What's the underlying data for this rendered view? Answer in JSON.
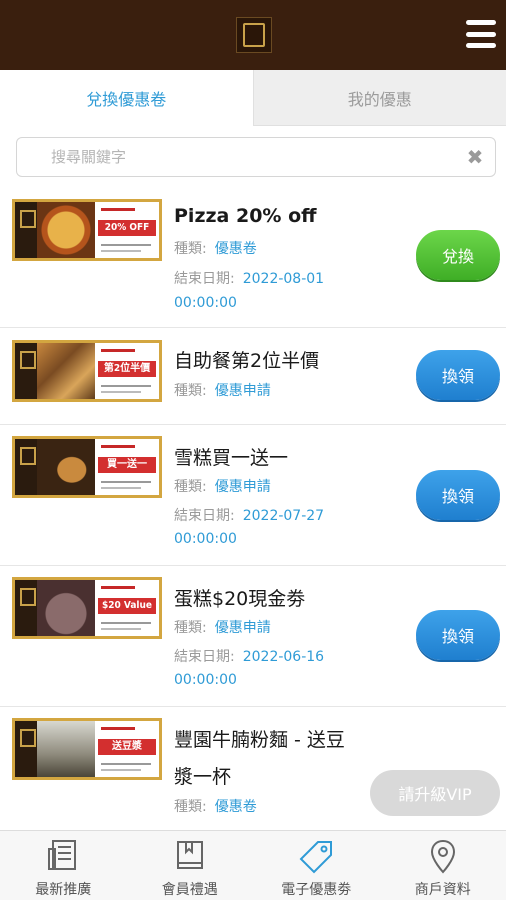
{
  "header": {
    "logo": "logo-icon",
    "menu": "hamburger-icon"
  },
  "tabs": {
    "redeem": "兌換優惠卷",
    "mine": "我的優惠"
  },
  "search": {
    "placeholder": "搜尋關鍵字",
    "clear": "✖"
  },
  "labels": {
    "type": "種類:",
    "end": "結束日期:"
  },
  "coupons": [
    {
      "title": "Pizza 20% off",
      "type": "優惠卷",
      "end_date": "2022-08-01",
      "end_time": "00:00:00",
      "button": "兌換",
      "button_color": "#4cbf2e",
      "thumb_text": "20% OFF"
    },
    {
      "title": "自助餐第2位半價",
      "type": "優惠申請",
      "button": "換領",
      "button_color": "#2a8ad9",
      "thumb_text": "第2位半價"
    },
    {
      "title": "雪糕買一送一",
      "type": "優惠申請",
      "end_date": "2022-07-27",
      "end_time": "00:00:00",
      "button": "換領",
      "button_color": "#2a8ad9",
      "thumb_text": "買一送一"
    },
    {
      "title": "蛋糕$20現金劵",
      "type": "優惠申請",
      "end_date": "2022-06-16",
      "end_time": "00:00:00",
      "button": "換領",
      "button_color": "#2a8ad9",
      "thumb_text": "$20 Value"
    },
    {
      "title_line1": "豐園牛腩粉麵 - 送豆",
      "title_line2": "漿一杯",
      "type": "優惠卷",
      "thumb_text": "送豆漿"
    }
  ],
  "vip_button": "請升級VIP",
  "bottom_nav": [
    {
      "label": "最新推廣",
      "icon": "news-icon"
    },
    {
      "label": "會員禮遇",
      "icon": "book-icon"
    },
    {
      "label": "電子優惠劵",
      "icon": "tag-icon",
      "active": true
    },
    {
      "label": "商戶資料",
      "icon": "location-pin-icon"
    }
  ]
}
